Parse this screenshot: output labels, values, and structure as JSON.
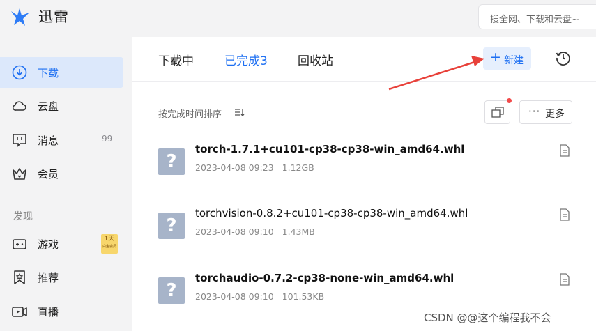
{
  "app": {
    "brand": "迅雷"
  },
  "search": {
    "placeholder": "搜全网、下载和云盘~"
  },
  "sidebar": {
    "items": [
      {
        "label": "下载",
        "icon": "download-circle-icon",
        "active": true
      },
      {
        "label": "云盘",
        "icon": "cloud-icon"
      },
      {
        "label": "消息",
        "icon": "message-icon",
        "count": "99"
      },
      {
        "label": "会员",
        "icon": "crown-icon"
      }
    ],
    "section": "发现",
    "discover": [
      {
        "label": "游戏",
        "icon": "gamepad-icon",
        "promo_top": "1天",
        "promo_sub": "白金会员"
      },
      {
        "label": "推荐",
        "icon": "bookmark-star-icon"
      },
      {
        "label": "直播",
        "icon": "live-video-icon"
      }
    ]
  },
  "tabs": [
    {
      "label": "下载中"
    },
    {
      "label": "已完成3",
      "active": true
    },
    {
      "label": "回收站"
    }
  ],
  "toolbar": {
    "new_plus": "+",
    "new_label": "新建",
    "more_dots": "···",
    "more_label": "更多"
  },
  "list": {
    "sort_label": "按完成时间排序",
    "files": [
      {
        "name": "torch-1.7.1+cu101-cp38-cp38-win_amd64.whl",
        "date": "2023-04-08 09:23",
        "size": "1.12GB",
        "bold": true
      },
      {
        "name": "torchvision-0.8.2+cu101-cp38-cp38-win_amd64.whl",
        "date": "2023-04-08 09:10",
        "size": "1.43MB",
        "bold": false
      },
      {
        "name": "torchaudio-0.7.2-cp38-none-win_amd64.whl",
        "date": "2023-04-08 09:10",
        "size": "101.53KB",
        "bold": true
      }
    ],
    "file_icon_glyph": "?"
  },
  "watermark": "CSDN @@这个编程我不会",
  "colors": {
    "accent": "#1d6ff2",
    "arrow": "#e8413a",
    "sidebar_bg": "#f3f3f4",
    "active_bg": "#dce8fb"
  }
}
